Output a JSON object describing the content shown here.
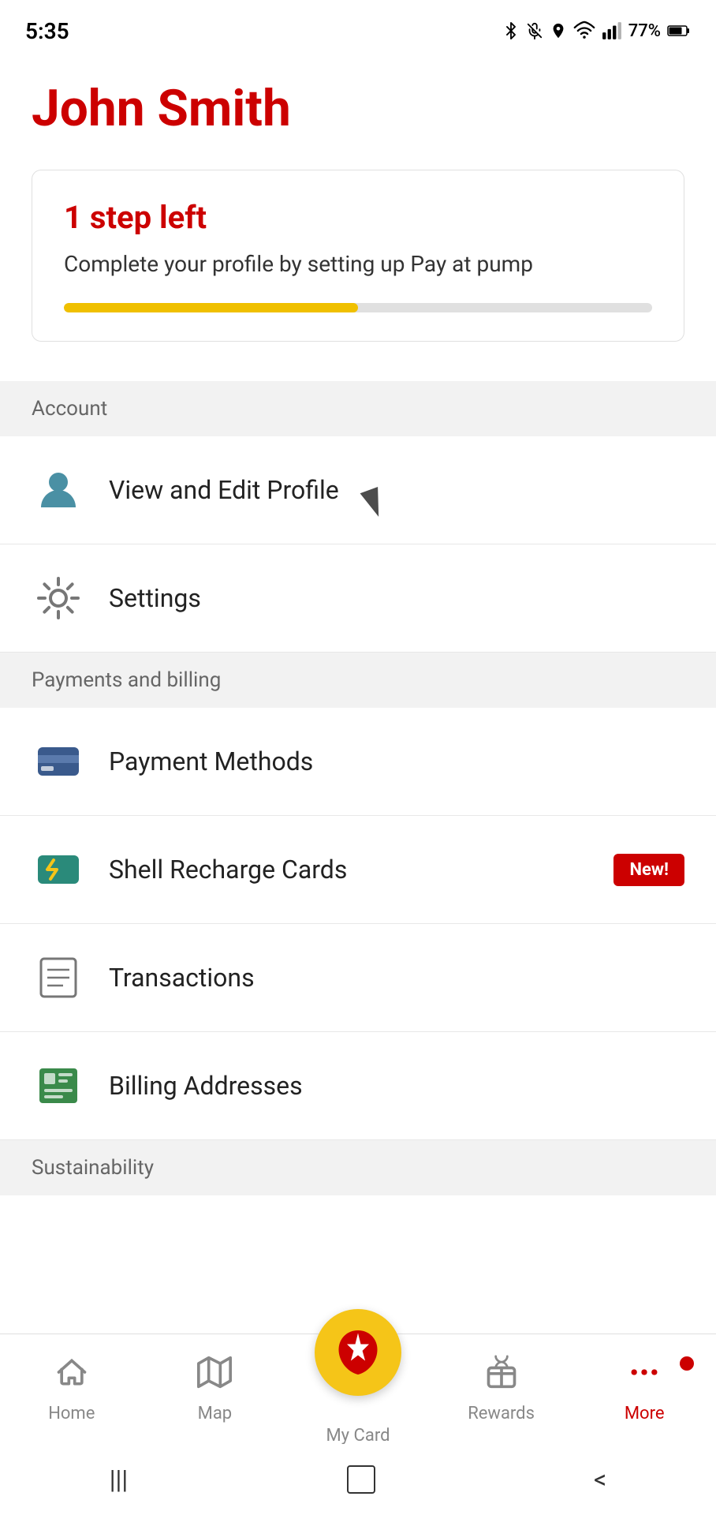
{
  "statusBar": {
    "time": "5:35",
    "battery": "77%",
    "icons": "bluetooth mute location wifi signal battery"
  },
  "header": {
    "userName": "John Smith"
  },
  "profileCard": {
    "stepsLeft": "1 step left",
    "description": "Complete your profile by setting up Pay at pump",
    "progressPercent": 50
  },
  "sections": {
    "account": {
      "label": "Account",
      "items": [
        {
          "id": "view-edit-profile",
          "label": "View and Edit Profile",
          "icon": "person-icon"
        },
        {
          "id": "settings",
          "label": "Settings",
          "icon": "settings-icon"
        }
      ]
    },
    "paymentsAndBilling": {
      "label": "Payments and billing",
      "items": [
        {
          "id": "payment-methods",
          "label": "Payment Methods",
          "icon": "credit-card-icon",
          "badge": null
        },
        {
          "id": "shell-recharge-cards",
          "label": "Shell Recharge Cards",
          "icon": "recharge-icon",
          "badge": "New!"
        },
        {
          "id": "transactions",
          "label": "Transactions",
          "icon": "transactions-icon",
          "badge": null
        },
        {
          "id": "billing-addresses",
          "label": "Billing Addresses",
          "icon": "billing-icon",
          "badge": null
        }
      ]
    },
    "sustainability": {
      "label": "Sustainability"
    }
  },
  "bottomNav": {
    "items": [
      {
        "id": "home",
        "label": "Home",
        "icon": "home-icon",
        "active": false
      },
      {
        "id": "map",
        "label": "Map",
        "icon": "map-icon",
        "active": false
      },
      {
        "id": "my-card",
        "label": "My Card",
        "icon": "shell-icon",
        "active": false,
        "isFab": true
      },
      {
        "id": "rewards",
        "label": "Rewards",
        "icon": "rewards-icon",
        "active": false
      },
      {
        "id": "more",
        "label": "More",
        "icon": "more-icon",
        "active": true,
        "hasDot": true
      }
    ]
  },
  "systemNav": {
    "menu": "|||",
    "home": "○",
    "back": "<"
  }
}
